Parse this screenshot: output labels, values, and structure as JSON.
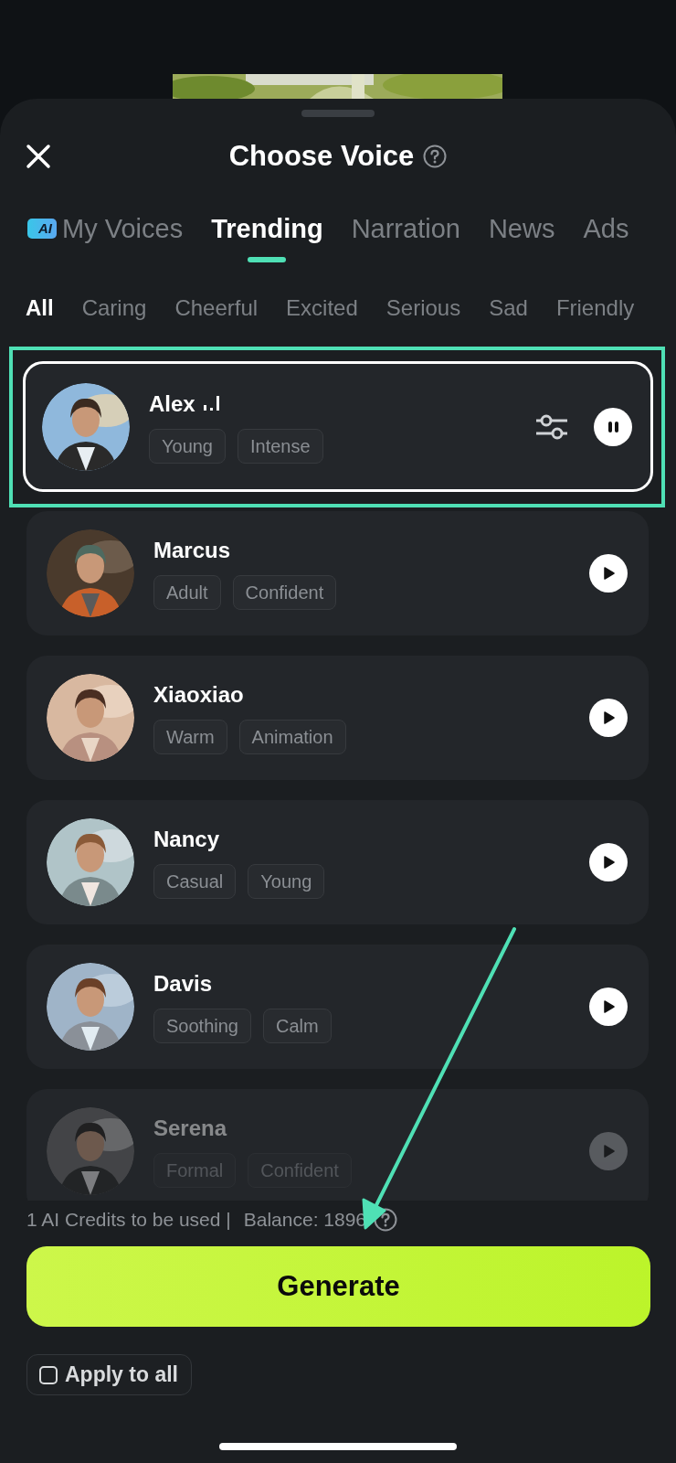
{
  "header": {
    "title": "Choose Voice"
  },
  "tabs": [
    {
      "label": "My Voices",
      "badge": "AI",
      "selected": false
    },
    {
      "label": "Trending",
      "selected": true
    },
    {
      "label": "Narration",
      "selected": false
    },
    {
      "label": "News",
      "selected": false
    },
    {
      "label": "Ads",
      "selected": false
    }
  ],
  "filters": [
    {
      "label": "All",
      "selected": true
    },
    {
      "label": "Caring",
      "selected": false
    },
    {
      "label": "Cheerful",
      "selected": false
    },
    {
      "label": "Excited",
      "selected": false
    },
    {
      "label": "Serious",
      "selected": false
    },
    {
      "label": "Sad",
      "selected": false
    },
    {
      "label": "Friendly",
      "selected": false
    }
  ],
  "voices": [
    {
      "name": "Alex",
      "tags": [
        "Young",
        "Intense"
      ],
      "selected": true,
      "highlighted": true,
      "faded": false
    },
    {
      "name": "Marcus",
      "tags": [
        "Adult",
        "Confident"
      ],
      "selected": false,
      "highlighted": false,
      "faded": false
    },
    {
      "name": "Xiaoxiao",
      "tags": [
        "Warm",
        "Animation"
      ],
      "selected": false,
      "highlighted": false,
      "faded": false
    },
    {
      "name": "Nancy",
      "tags": [
        "Casual",
        "Young"
      ],
      "selected": false,
      "highlighted": false,
      "faded": false
    },
    {
      "name": "Davis",
      "tags": [
        "Soothing",
        "Calm"
      ],
      "selected": false,
      "highlighted": false,
      "faded": false
    },
    {
      "name": "Serena",
      "tags": [
        "Formal",
        "Confident"
      ],
      "selected": false,
      "highlighted": false,
      "faded": true
    }
  ],
  "footer": {
    "credits": "1 AI Credits to be used |",
    "balance": "Balance: 1896"
  },
  "generate": "Generate",
  "apply_all": {
    "label": "Apply to all",
    "checked": false
  },
  "pointer_arrow": true
}
